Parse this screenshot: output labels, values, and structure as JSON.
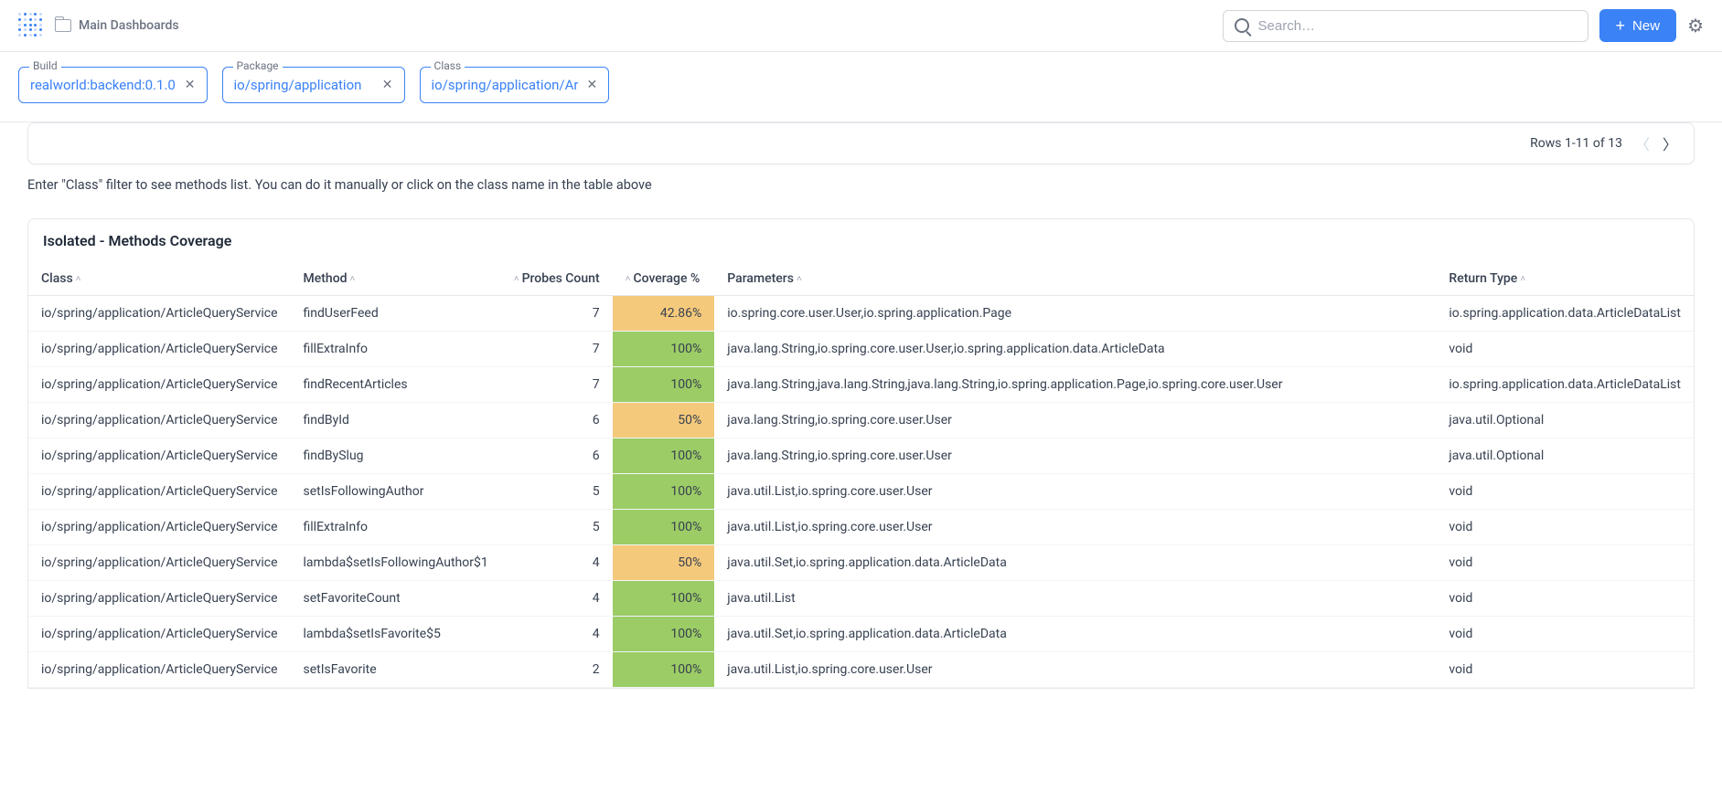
{
  "header": {
    "breadcrumb": "Main Dashboards",
    "search_placeholder": "Search…",
    "new_label": "New"
  },
  "filters": {
    "build": {
      "label": "Build",
      "value": "realworld:backend:0.1.0"
    },
    "package": {
      "label": "Package",
      "value": "io/spring/application"
    },
    "class": {
      "label": "Class",
      "value": "io/spring/application/Arti"
    }
  },
  "pagination": {
    "rows_text": "Rows 1-11 of 13"
  },
  "hint": "Enter \"Class\" filter to see methods list. You can do it manually or click on the class name in the table above",
  "table": {
    "title": "Isolated - Methods Coverage",
    "columns": {
      "class": "Class",
      "method": "Method",
      "probes": "Probes Count",
      "coverage": "Coverage %",
      "parameters": "Parameters",
      "returnType": "Return Type"
    },
    "rows": [
      {
        "class": "io/spring/application/ArticleQueryService",
        "method": "findUserFeed",
        "probes": 7,
        "coverage": "42.86%",
        "covClass": "cov-amber",
        "parameters": "io.spring.core.user.User,io.spring.application.Page",
        "returnType": "io.spring.application.data.ArticleDataList"
      },
      {
        "class": "io/spring/application/ArticleQueryService",
        "method": "fillExtraInfo",
        "probes": 7,
        "coverage": "100%",
        "covClass": "cov-green",
        "parameters": "java.lang.String,io.spring.core.user.User,io.spring.application.data.ArticleData",
        "returnType": "void"
      },
      {
        "class": "io/spring/application/ArticleQueryService",
        "method": "findRecentArticles",
        "probes": 7,
        "coverage": "100%",
        "covClass": "cov-green",
        "parameters": "java.lang.String,java.lang.String,java.lang.String,io.spring.application.Page,io.spring.core.user.User",
        "returnType": "io.spring.application.data.ArticleDataList"
      },
      {
        "class": "io/spring/application/ArticleQueryService",
        "method": "findById",
        "probes": 6,
        "coverage": "50%",
        "covClass": "cov-amber",
        "parameters": "java.lang.String,io.spring.core.user.User",
        "returnType": "java.util.Optional"
      },
      {
        "class": "io/spring/application/ArticleQueryService",
        "method": "findBySlug",
        "probes": 6,
        "coverage": "100%",
        "covClass": "cov-green",
        "parameters": "java.lang.String,io.spring.core.user.User",
        "returnType": "java.util.Optional"
      },
      {
        "class": "io/spring/application/ArticleQueryService",
        "method": "setIsFollowingAuthor",
        "probes": 5,
        "coverage": "100%",
        "covClass": "cov-green",
        "parameters": "java.util.List,io.spring.core.user.User",
        "returnType": "void"
      },
      {
        "class": "io/spring/application/ArticleQueryService",
        "method": "fillExtraInfo",
        "probes": 5,
        "coverage": "100%",
        "covClass": "cov-green",
        "parameters": "java.util.List,io.spring.core.user.User",
        "returnType": "void"
      },
      {
        "class": "io/spring/application/ArticleQueryService",
        "method": "lambda$setIsFollowingAuthor$1",
        "probes": 4,
        "coverage": "50%",
        "covClass": "cov-amber",
        "parameters": "java.util.Set,io.spring.application.data.ArticleData",
        "returnType": "void"
      },
      {
        "class": "io/spring/application/ArticleQueryService",
        "method": "setFavoriteCount",
        "probes": 4,
        "coverage": "100%",
        "covClass": "cov-green",
        "parameters": "java.util.List",
        "returnType": "void"
      },
      {
        "class": "io/spring/application/ArticleQueryService",
        "method": "lambda$setIsFavorite$5",
        "probes": 4,
        "coverage": "100%",
        "covClass": "cov-green",
        "parameters": "java.util.Set,io.spring.application.data.ArticleData",
        "returnType": "void"
      },
      {
        "class": "io/spring/application/ArticleQueryService",
        "method": "setIsFavorite",
        "probes": 2,
        "coverage": "100%",
        "covClass": "cov-green",
        "parameters": "java.util.List,io.spring.core.user.User",
        "returnType": "void"
      }
    ]
  }
}
